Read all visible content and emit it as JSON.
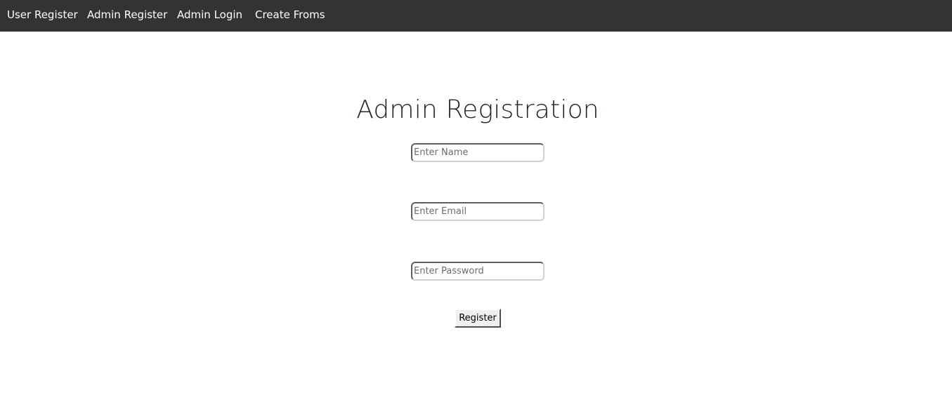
{
  "nav": {
    "items": [
      {
        "label": "User Register"
      },
      {
        "label": "Admin Register"
      },
      {
        "label": "Admin Login"
      },
      {
        "label": "Create Froms"
      }
    ]
  },
  "form": {
    "title": "Admin Registration",
    "name": {
      "placeholder": "Enter Name",
      "value": ""
    },
    "email": {
      "placeholder": "Enter Email",
      "value": ""
    },
    "password": {
      "placeholder": "Enter Password",
      "value": ""
    },
    "submit_label": "Register"
  },
  "colors": {
    "navbar_bg": "#333333",
    "nav_text": "#ffffff",
    "page_bg": "#ffffff",
    "title_text": "#212529"
  }
}
